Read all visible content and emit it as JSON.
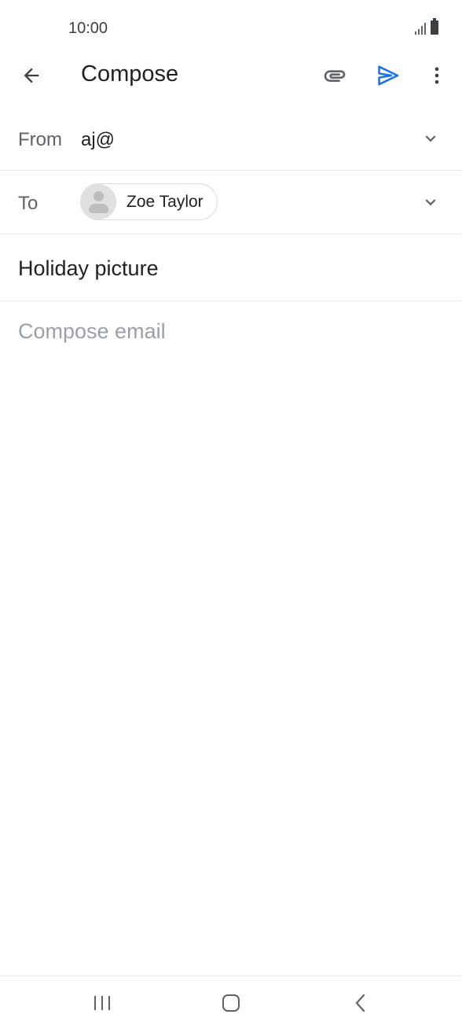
{
  "status_bar": {
    "time": "10:00"
  },
  "app_bar": {
    "title": "Compose",
    "icons": [
      "back-arrow-icon",
      "attachment-icon",
      "send-icon",
      "more-vert-icon"
    ],
    "send_color": "#1a73e8"
  },
  "from": {
    "label": "From",
    "value": "aj@"
  },
  "to": {
    "label": "To",
    "recipients": [
      {
        "name": "Zoe Taylor"
      }
    ]
  },
  "subject": {
    "value": "Holiday picture"
  },
  "body": {
    "placeholder": "Compose email"
  },
  "nav_bar": {
    "icons": [
      "recents-icon",
      "home-icon",
      "nav-back-icon"
    ]
  }
}
